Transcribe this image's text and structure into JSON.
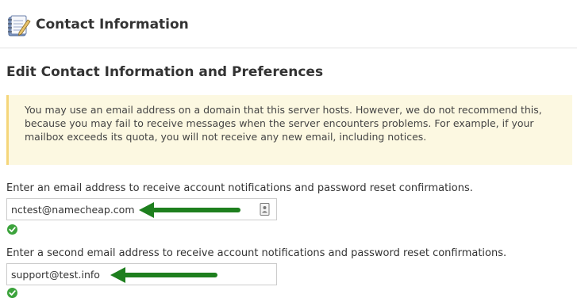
{
  "header": {
    "title": "Contact Information",
    "icon": "contact-book-icon"
  },
  "section": {
    "title": "Edit Contact Information and Preferences"
  },
  "alert": {
    "message": "You may use an email address on a domain that this server hosts. However, we do not recommend this, because you may fail to receive messages when the server encounters problems. For example, if your mailbox exceeds its quota, you will not receive any new email, including notices."
  },
  "primary_email": {
    "label": "Enter an email address to receive account notifications and password reset confirmations.",
    "value": "nctest@namecheap.com",
    "valid": true
  },
  "secondary_email": {
    "label": "Enter a second email address to receive account notifications and password reset confirmations.",
    "value": "support@test.info",
    "valid": true
  },
  "colors": {
    "alert_background": "#fcf8e1",
    "alert_border": "#f5d67a",
    "valid_check": "#3ca33c",
    "annotation_arrow": "#1e7f1e"
  }
}
